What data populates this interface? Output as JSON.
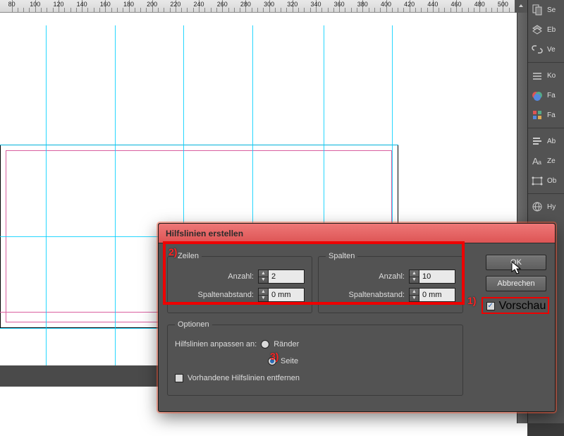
{
  "ruler": {
    "start": 80,
    "end": 500,
    "step": 20
  },
  "panels": [
    {
      "icon": "pages",
      "label": "Se"
    },
    {
      "icon": "layers",
      "label": "Eb"
    },
    {
      "icon": "links",
      "label": "Ve"
    },
    {
      "sep": true
    },
    {
      "icon": "stroke",
      "label": "Ko"
    },
    {
      "icon": "swatches",
      "label": "Fa"
    },
    {
      "icon": "swatches2",
      "label": "Fa"
    },
    {
      "sep": true
    },
    {
      "icon": "align",
      "label": "Ab"
    },
    {
      "icon": "char",
      "label": "Ze"
    },
    {
      "icon": "object",
      "label": "Ob"
    },
    {
      "sep": true
    },
    {
      "icon": "links2",
      "label": "Hy"
    }
  ],
  "dialog": {
    "title": "Hilfslinien erstellen",
    "rows_legend": "Zeilen",
    "cols_legend": "Spalten",
    "count_label": "Anzahl:",
    "gutter_label": "Spaltenabstand:",
    "rows_count": "2",
    "rows_gutter": "0 mm",
    "cols_count": "10",
    "cols_gutter": "0 mm",
    "options_legend": "Optionen",
    "fit_label": "Hilfslinien anpassen an:",
    "fit_margins": "Ränder",
    "fit_page": "Seite",
    "remove_existing": "Vorhandene Hilfslinien entfernen",
    "ok": "OK",
    "cancel": "Abbrechen",
    "preview": "Vorschau"
  },
  "annotations": {
    "a2": "2)",
    "a3": "3)",
    "a1": "1)"
  },
  "guides": {
    "v_positions": [
      65,
      163,
      260,
      358,
      459,
      556
    ],
    "h_positions": [
      0,
      130,
      260
    ]
  }
}
